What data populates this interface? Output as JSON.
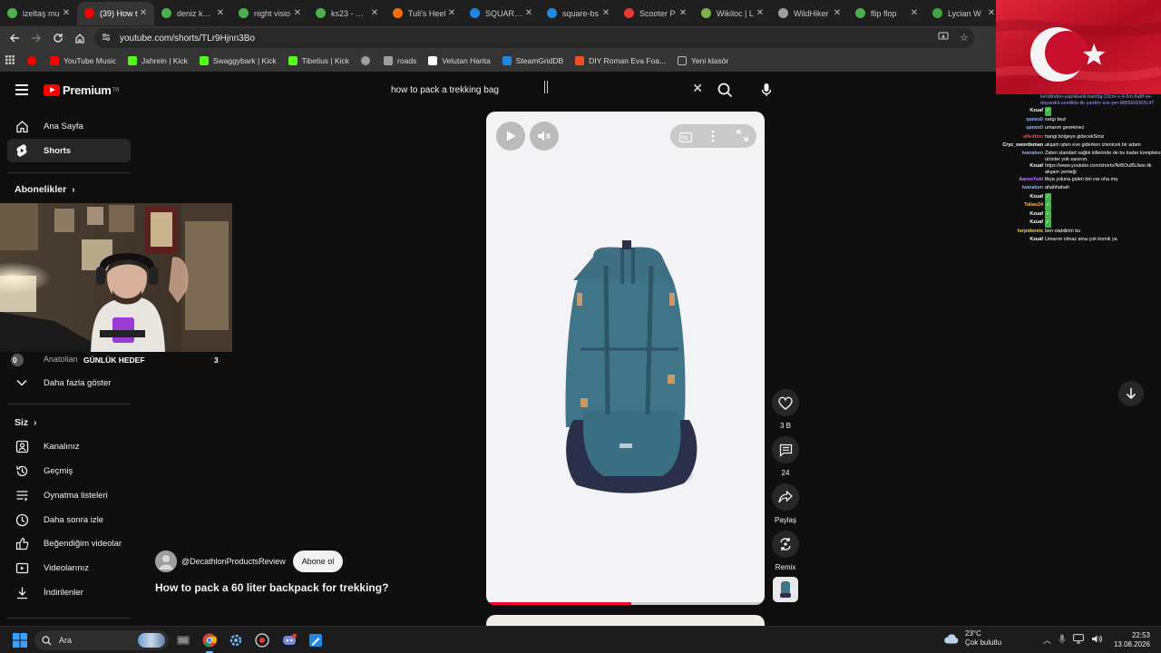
{
  "tabs": [
    {
      "title": "izeltaş mu",
      "color": "#4caf50",
      "active": false
    },
    {
      "title": "(39) How t",
      "color": "#ff0000",
      "active": true
    },
    {
      "title": "deniz kuvv",
      "color": "#4caf50",
      "active": false
    },
    {
      "title": "night visio",
      "color": "#4caf50",
      "active": false
    },
    {
      "title": "ks23 - Goo",
      "color": "#4caf50",
      "active": false
    },
    {
      "title": "Tuli's Heel",
      "color": "#ff6d00",
      "active": false
    },
    {
      "title": "SQUARE E",
      "color": "#1e88e5",
      "active": false
    },
    {
      "title": "square-bs",
      "color": "#1e88e5",
      "active": false
    },
    {
      "title": "Scooter P",
      "color": "#e53935",
      "active": false
    },
    {
      "title": "Wikiloc | L",
      "color": "#7cb342",
      "active": false
    },
    {
      "title": "WildHiker",
      "color": "#9e9e9e",
      "active": false
    },
    {
      "title": "flip flop",
      "color": "#4caf50",
      "active": false
    },
    {
      "title": "Lycian W",
      "color": "#43a047",
      "active": false
    }
  ],
  "address": {
    "url": "youtube.com/shorts/TLr9Hjnn3Bo"
  },
  "bookmarks": [
    {
      "label": "",
      "color": "#ff0000"
    },
    {
      "label": "YouTube Music",
      "color": "#ff0000"
    },
    {
      "label": "Jahrein | Kick",
      "color": "#53fc18"
    },
    {
      "label": "Swaggybark | Kick",
      "color": "#53fc18"
    },
    {
      "label": "Tibetius | Kick",
      "color": "#53fc18"
    },
    {
      "label": "",
      "color": "#9e9e9e"
    },
    {
      "label": "roads",
      "color": "#9e9e9e"
    },
    {
      "label": "Velutan Harita",
      "color": "#ffffff"
    },
    {
      "label": "SteamGridDB",
      "color": "#1e88e5"
    },
    {
      "label": "DIY Roman Eva Foa...",
      "color": "#f4511e"
    },
    {
      "label": "Yeni klasör",
      "color": "#bdbdbd"
    }
  ],
  "header": {
    "logo_text": "Premium",
    "logo_region": "TR",
    "search_query": "how to pack a trekking bag"
  },
  "sidebar": {
    "items": [
      {
        "label": "Ana Sayfa",
        "icon": "home-icon",
        "active": false
      },
      {
        "label": "Shorts",
        "icon": "shorts-icon",
        "active": true
      }
    ],
    "subscriptions_heading": "Abonelikler",
    "subscription_channel": "Anatolian",
    "show_more": "Daha fazla göster",
    "you_heading": "Siz",
    "you_items": [
      {
        "label": "Kanalınız",
        "icon": "channel-icon"
      },
      {
        "label": "Geçmiş",
        "icon": "history-icon"
      },
      {
        "label": "Oynatma listeleri",
        "icon": "playlists-icon"
      },
      {
        "label": "Daha sonra izle",
        "icon": "watch-later-icon"
      },
      {
        "label": "Beğendiğim videolar",
        "icon": "liked-icon"
      },
      {
        "label": "Videolarınız",
        "icon": "your-videos-icon"
      },
      {
        "label": "İndirilenler",
        "icon": "downloads-icon"
      }
    ]
  },
  "overlay": {
    "goal_label": "GÜNLÜK HEDEF",
    "goal_left": "0",
    "goal_right": "3"
  },
  "short": {
    "channel": "@DecathlonProductsReview",
    "subscribe_label": "Abone ol",
    "title": "How to pack a 60 liter backpack for trekking?",
    "progress": 0.52,
    "likes": "3 B",
    "comments": "24",
    "share_label": "Paylaş",
    "remix_label": "Remix"
  },
  "chat": [
    {
      "user": "",
      "msg": "kendinden-yapiskanli-bandaj-10cm-x-4-5m-hafif-ve-dayanikli-ozellikle-ilk-yardim-icin-pm-M800000KN.IIT",
      "color": "#9f9fff",
      "wrap": true
    },
    {
      "user": "Kzuaf",
      "msg": "✓",
      "color": "#ffffff"
    },
    {
      "user": "qanes0",
      "msg": "sargı bezi",
      "color": "#8fb4ff"
    },
    {
      "user": "qanes0",
      "msg": "umarım gerekmez",
      "color": "#8fb4ff"
    },
    {
      "user": "alfedlins",
      "msg": "hangi bolgeye gidecekSiniz",
      "color": "#ff4040"
    },
    {
      "user": "Cryz_swordsman",
      "msg": "akşam işten eve giderken izlenicek bir adam",
      "color": "#ffffff"
    },
    {
      "user": "ivanaben",
      "msg": "Zaten standart sağlık kitlerinde de bu kadar kompleks ürünler yok sanırım.",
      "color": "#8fb4ff",
      "wrap": true
    },
    {
      "user": "Kzuaf",
      "msg": "https://www.youtube.com/shorts/NrBOu85Jiwo ilk akşam yemeği",
      "color": "#ffffff",
      "wrap": true
    },
    {
      "user": "AaronYuki",
      "msg": "likya yoluna giden biri var oha mq",
      "color": "#c77dff"
    },
    {
      "user": "ivanaben",
      "msg": "ahahhahah",
      "color": "#8fb4ff"
    },
    {
      "user": "Kzuaf",
      "msg": "✓",
      "color": "#ffffff"
    },
    {
      "user": "Talias24",
      "msg": "✓",
      "color": "#ffb74d"
    },
    {
      "user": "Kzuaf",
      "msg": "✓",
      "color": "#ffffff"
    },
    {
      "user": "Kzuaf",
      "msg": "✓",
      "color": "#ffffff"
    },
    {
      "user": "torpidoreis",
      "msg": "ben olabilirim bu",
      "color": "#ffd54f"
    },
    {
      "user": "Kzuaf",
      "msg": "Umarım olmaz ama çok komik ya",
      "color": "#ffffff"
    }
  ],
  "taskbar": {
    "search_placeholder": "Ara",
    "temperature": "23°C",
    "weather": "Çok bulutlu",
    "time": "22:53",
    "date": "13.08.2026"
  },
  "colors": {
    "accent_red": "#ff0033",
    "bg": "#0f0f0f"
  }
}
